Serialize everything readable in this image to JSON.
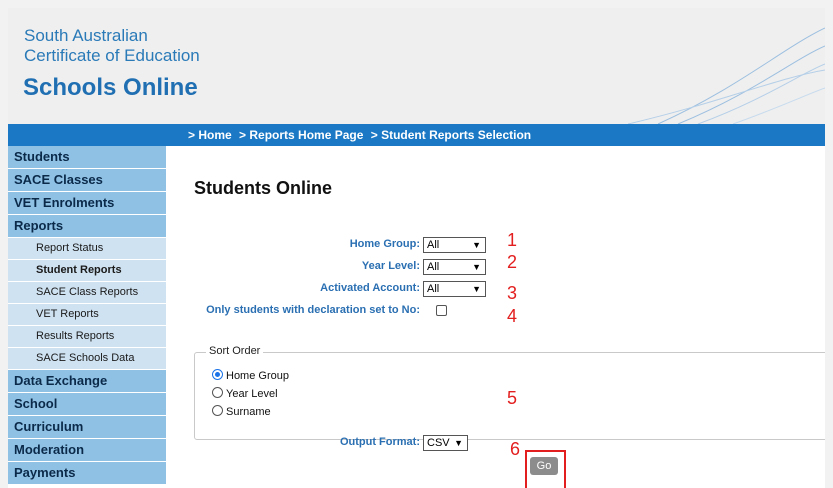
{
  "header": {
    "brand_line1": "South Australian",
    "brand_line2": "Certificate of Education",
    "app_name": "Schools Online"
  },
  "breadcrumb": {
    "items": [
      "> Home",
      "> Reports Home Page",
      "> Student Reports Selection"
    ]
  },
  "sidebar": {
    "items": [
      {
        "label": "Students"
      },
      {
        "label": "SACE Classes"
      },
      {
        "label": "VET Enrolments"
      },
      {
        "label": "Reports"
      },
      {
        "label": "Report Status"
      },
      {
        "label": "Student Reports"
      },
      {
        "label": "SACE Class Reports"
      },
      {
        "label": "VET Reports"
      },
      {
        "label": "Results Reports"
      },
      {
        "label": "SACE Schools Data"
      },
      {
        "label": "Data Exchange"
      },
      {
        "label": "School"
      },
      {
        "label": "Curriculum"
      },
      {
        "label": "Moderation"
      },
      {
        "label": "Payments"
      }
    ]
  },
  "main": {
    "title": "Students Online",
    "home_group_label": "Home Group:",
    "home_group_value": "All",
    "year_level_label": "Year Level:",
    "year_level_value": "All",
    "activated_label": "Activated Account:",
    "activated_value": "All",
    "declaration_label": "Only students with declaration set to No:",
    "sort_order_legend": "Sort Order",
    "sort_options": [
      "Home Group",
      "Year Level",
      "Surname"
    ],
    "sort_selected": "Home Group",
    "output_format_label": "Output Format:",
    "output_format_value": "CSV",
    "go_label": "Go"
  },
  "annotations": [
    "1",
    "2",
    "3",
    "4",
    "5",
    "6"
  ],
  "colors": {
    "accent": "#1b78c4",
    "sidebar_main": "#8fc1e4",
    "sidebar_sub": "#cfe2f1",
    "annotation": "#e31e1e"
  }
}
